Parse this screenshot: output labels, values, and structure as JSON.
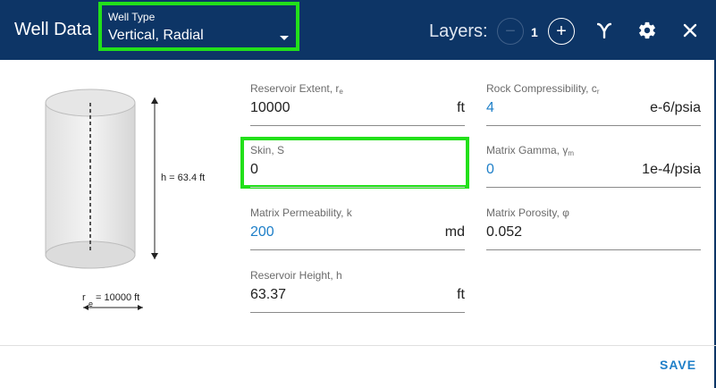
{
  "header": {
    "title": "Well Data",
    "well_type_label": "Well Type",
    "well_type_value": "Vertical, Radial",
    "layers_label": "Layers:",
    "layers_count": "1",
    "minus_symbol": "−",
    "plus_symbol": "+"
  },
  "diagram": {
    "height_label": "h = 63.4 ft",
    "radius_prefix": "r",
    "radius_sub": "e",
    "radius_value": "= 10000 ft"
  },
  "fields": {
    "reservoir_extent": {
      "label": "Reservoir Extent, r",
      "label_sub": "e",
      "value": "10000",
      "unit": "ft"
    },
    "skin": {
      "label": "Skin, S",
      "value": "0"
    },
    "matrix_permeability": {
      "label": "Matrix Permeability, k",
      "value": "200",
      "unit": "md"
    },
    "reservoir_height": {
      "label": "Reservoir Height, h",
      "value": "63.37",
      "unit": "ft"
    },
    "rock_compressibility": {
      "label": "Rock Compressibility, c",
      "label_sub": "r",
      "value": "4",
      "unit": "e-6/psia"
    },
    "matrix_gamma": {
      "label": "Matrix Gamma, γ",
      "label_sub": "m",
      "value": "0",
      "unit": "1e-4/psia"
    },
    "matrix_porosity": {
      "label": "Matrix Porosity, φ",
      "value": "0.052"
    }
  },
  "footer": {
    "save_label": "SAVE"
  },
  "colors": {
    "header_bg": "#0d3566",
    "highlight": "#22e01a",
    "accent_blue": "#1e7fc8"
  },
  "icons": [
    "minus-circle-icon",
    "plus-circle-icon",
    "gamma-icon",
    "gear-icon",
    "close-icon"
  ]
}
